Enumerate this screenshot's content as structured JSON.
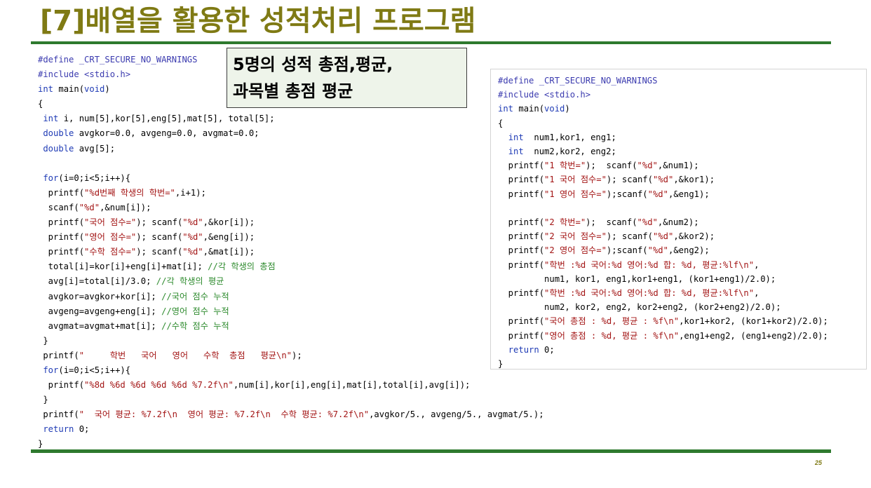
{
  "title": "[7]배열을 활용한 성적처리 프로그램",
  "callout": {
    "line1": "5명의 성적 총점,평균,",
    "line2": "과목별 총점 평균"
  },
  "page_number": "25",
  "left_code": [
    [
      [
        "pre",
        "#define _CRT_SECURE_NO_WARNINGS"
      ]
    ],
    [
      [
        "pre",
        "#include <stdio.h>"
      ]
    ],
    [
      [
        "kw",
        "int"
      ],
      [
        "t",
        " main("
      ],
      [
        "kw",
        "void"
      ],
      [
        "t",
        ")"
      ]
    ],
    [
      [
        "t",
        "{"
      ]
    ],
    [
      [
        "t",
        " "
      ],
      [
        "kw",
        "int"
      ],
      [
        "t",
        " i, num[5],kor[5],eng[5],mat[5], total[5];"
      ]
    ],
    [
      [
        "t",
        " "
      ],
      [
        "kw",
        "double"
      ],
      [
        "t",
        " avgkor=0.0, avgeng=0.0, avgmat=0.0;"
      ]
    ],
    [
      [
        "t",
        " "
      ],
      [
        "kw",
        "double"
      ],
      [
        "t",
        " avg[5];"
      ]
    ],
    [
      [
        "t",
        ""
      ]
    ],
    [
      [
        "t",
        " "
      ],
      [
        "kw",
        "for"
      ],
      [
        "t",
        "(i=0;i<5;i++){"
      ]
    ],
    [
      [
        "t",
        "  printf("
      ],
      [
        "str",
        "\"%d번째 학생의 학번=\""
      ],
      [
        "t",
        ",i+1);"
      ]
    ],
    [
      [
        "t",
        "  scanf("
      ],
      [
        "str",
        "\"%d\""
      ],
      [
        "t",
        ",&num[i]);"
      ]
    ],
    [
      [
        "t",
        "  printf("
      ],
      [
        "str",
        "\"국어 점수=\""
      ],
      [
        "t",
        "); scanf("
      ],
      [
        "str",
        "\"%d\""
      ],
      [
        "t",
        ",&kor[i]);"
      ]
    ],
    [
      [
        "t",
        "  printf("
      ],
      [
        "str",
        "\"영어 점수=\""
      ],
      [
        "t",
        "); scanf("
      ],
      [
        "str",
        "\"%d\""
      ],
      [
        "t",
        ",&eng[i]);"
      ]
    ],
    [
      [
        "t",
        "  printf("
      ],
      [
        "str",
        "\"수학 점수=\""
      ],
      [
        "t",
        "); scanf("
      ],
      [
        "str",
        "\"%d\""
      ],
      [
        "t",
        ",&mat[i]);"
      ]
    ],
    [
      [
        "t",
        "  total[i]=kor[i]+eng[i]+mat[i]; "
      ],
      [
        "cm",
        "//각 학생의 총점"
      ]
    ],
    [
      [
        "t",
        "  avg[i]=total[i]/3.0; "
      ],
      [
        "cm",
        "//각 학생의 평균"
      ]
    ],
    [
      [
        "t",
        "  avgkor=avgkor+kor[i]; "
      ],
      [
        "cm",
        "//국어 점수 누적"
      ]
    ],
    [
      [
        "t",
        "  avgeng=avgeng+eng[i]; "
      ],
      [
        "cm",
        "//영어 점수 누적"
      ]
    ],
    [
      [
        "t",
        "  avgmat=avgmat+mat[i]; "
      ],
      [
        "cm",
        "//수학 점수 누적"
      ]
    ],
    [
      [
        "t",
        " }"
      ]
    ],
    [
      [
        "t",
        " printf("
      ],
      [
        "str",
        "\"     학번   국어   영어   수학  총점   평균\\n\""
      ],
      [
        "t",
        ");"
      ]
    ],
    [
      [
        "t",
        " "
      ],
      [
        "kw",
        "for"
      ],
      [
        "t",
        "(i=0;i<5;i++){"
      ]
    ],
    [
      [
        "t",
        "  printf("
      ],
      [
        "str",
        "\"%8d %6d %6d %6d %6d %7.2f\\n\""
      ],
      [
        "t",
        ",num[i],kor[i],eng[i],mat[i],total[i],avg[i]);"
      ]
    ],
    [
      [
        "t",
        " }"
      ]
    ],
    [
      [
        "t",
        " printf("
      ],
      [
        "str",
        "\"  국어 평균: %7.2f\\n  영어 평균: %7.2f\\n  수학 평균: %7.2f\\n\""
      ],
      [
        "t",
        ",avgkor/5., avgeng/5., avgmat/5.);"
      ]
    ],
    [
      [
        "t",
        " "
      ],
      [
        "kw",
        "return"
      ],
      [
        "t",
        " 0;"
      ]
    ],
    [
      [
        "t",
        "}"
      ]
    ]
  ],
  "right_code": [
    [
      [
        "pre",
        "#define _CRT_SECURE_NO_WARNINGS"
      ]
    ],
    [
      [
        "pre",
        "#include <stdio.h>"
      ]
    ],
    [
      [
        "kw",
        "int"
      ],
      [
        "t",
        " main("
      ],
      [
        "kw",
        "void"
      ],
      [
        "t",
        ")"
      ]
    ],
    [
      [
        "t",
        "{"
      ]
    ],
    [
      [
        "t",
        "  "
      ],
      [
        "kw",
        "int"
      ],
      [
        "t",
        "  num1,kor1, eng1;"
      ]
    ],
    [
      [
        "t",
        "  "
      ],
      [
        "kw",
        "int"
      ],
      [
        "t",
        "  num2,kor2, eng2;"
      ]
    ],
    [
      [
        "t",
        "  printf("
      ],
      [
        "str",
        "\"1 학번=\""
      ],
      [
        "t",
        ");  scanf("
      ],
      [
        "str",
        "\"%d\""
      ],
      [
        "t",
        ",&num1);"
      ]
    ],
    [
      [
        "t",
        "  printf("
      ],
      [
        "str",
        "\"1 국어 점수=\""
      ],
      [
        "t",
        "); scanf("
      ],
      [
        "str",
        "\"%d\""
      ],
      [
        "t",
        ",&kor1);"
      ]
    ],
    [
      [
        "t",
        "  printf("
      ],
      [
        "str",
        "\"1 영어 점수=\""
      ],
      [
        "t",
        ");scanf("
      ],
      [
        "str",
        "\"%d\""
      ],
      [
        "t",
        ",&eng1);"
      ]
    ],
    [
      [
        "t",
        ""
      ]
    ],
    [
      [
        "t",
        "  printf("
      ],
      [
        "str",
        "\"2 학번=\""
      ],
      [
        "t",
        ");  scanf("
      ],
      [
        "str",
        "\"%d\""
      ],
      [
        "t",
        ",&num2);"
      ]
    ],
    [
      [
        "t",
        "  printf("
      ],
      [
        "str",
        "\"2 국어 점수=\""
      ],
      [
        "t",
        "); scanf("
      ],
      [
        "str",
        "\"%d\""
      ],
      [
        "t",
        ",&kor2);"
      ]
    ],
    [
      [
        "t",
        "  printf("
      ],
      [
        "str",
        "\"2 영어 점수=\""
      ],
      [
        "t",
        ");scanf("
      ],
      [
        "str",
        "\"%d\""
      ],
      [
        "t",
        ",&eng2);"
      ]
    ],
    [
      [
        "t",
        "  printf("
      ],
      [
        "str",
        "\"학번 :%d 국어:%d 영어:%d 합: %d, 평균:%lf\\n\""
      ],
      [
        "t",
        ","
      ]
    ],
    [
      [
        "t",
        "         num1, kor1, eng1,kor1+eng1, (kor1+eng1)/2.0);"
      ]
    ],
    [
      [
        "t",
        "  printf("
      ],
      [
        "str",
        "\"학번 :%d 국어:%d 영어:%d 합: %d, 평균:%lf\\n\""
      ],
      [
        "t",
        ","
      ]
    ],
    [
      [
        "t",
        "         num2, kor2, eng2, kor2+eng2, (kor2+eng2)/2.0);"
      ]
    ],
    [
      [
        "t",
        "  printf("
      ],
      [
        "str",
        "\"국어 총점 : %d, 평균 : %f\\n\""
      ],
      [
        "t",
        ",kor1+kor2, (kor1+kor2)/2.0);"
      ]
    ],
    [
      [
        "t",
        "  printf("
      ],
      [
        "str",
        "\"영어 총점 : %d, 평균 : %f\\n\""
      ],
      [
        "t",
        ",eng1+eng2, (eng1+eng2)/2.0);"
      ]
    ],
    [
      [
        "t",
        "  "
      ],
      [
        "kw",
        "return"
      ],
      [
        "t",
        " 0;"
      ]
    ],
    [
      [
        "t",
        "}"
      ]
    ]
  ]
}
